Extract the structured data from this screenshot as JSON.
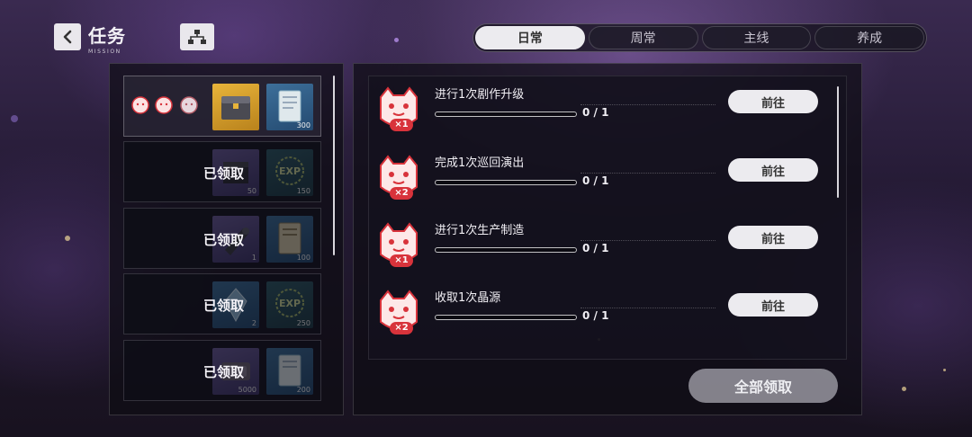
{
  "header": {
    "title": "任务",
    "subtitle": "MISSION",
    "back_icon": "chevron-left-icon",
    "tree_icon": "hierarchy-icon"
  },
  "tabs": [
    {
      "label": "日常",
      "active": true
    },
    {
      "label": "周常",
      "active": false
    },
    {
      "label": "主线",
      "active": false
    },
    {
      "label": "养成",
      "active": false
    }
  ],
  "rewards": [
    {
      "status": "",
      "items": [
        {
          "icon": "chest-icon",
          "qty": ""
        },
        {
          "icon": "card-icon",
          "qty": "300"
        }
      ]
    },
    {
      "status": "已领取",
      "items": [
        {
          "icon": "crate-icon",
          "qty": "50"
        },
        {
          "icon": "exp-icon",
          "qty": "150"
        }
      ]
    },
    {
      "status": "已领取",
      "items": [
        {
          "icon": "tool-icon",
          "qty": "1"
        },
        {
          "icon": "card-icon",
          "qty": "100"
        }
      ]
    },
    {
      "status": "已领取",
      "items": [
        {
          "icon": "crystal-icon",
          "qty": "2"
        },
        {
          "icon": "exp-icon",
          "qty": "250"
        }
      ]
    },
    {
      "status": "已领取",
      "items": [
        {
          "icon": "material-icon",
          "qty": "5000"
        },
        {
          "icon": "card-icon",
          "qty": "200"
        }
      ]
    }
  ],
  "tasks": [
    {
      "name": "进行1次剧作升级",
      "multiplier": "×1",
      "progress_text": "0 / 1",
      "progress": 0,
      "button": "前往"
    },
    {
      "name": "完成1次巡回演出",
      "multiplier": "×2",
      "progress_text": "0 / 1",
      "progress": 0,
      "button": "前往"
    },
    {
      "name": "进行1次生产制造",
      "multiplier": "×1",
      "progress_text": "0 / 1",
      "progress": 0,
      "button": "前往"
    },
    {
      "name": "收取1次晶源",
      "multiplier": "×2",
      "progress_text": "0 / 1",
      "progress": 0,
      "button": "前往"
    }
  ],
  "claim_all_label": "全部领取",
  "colors": {
    "accent_red": "#d8333b",
    "button_bg": "#ecebef",
    "gold_box": "#e8b43a",
    "blue_box": "#3d6f9a"
  }
}
